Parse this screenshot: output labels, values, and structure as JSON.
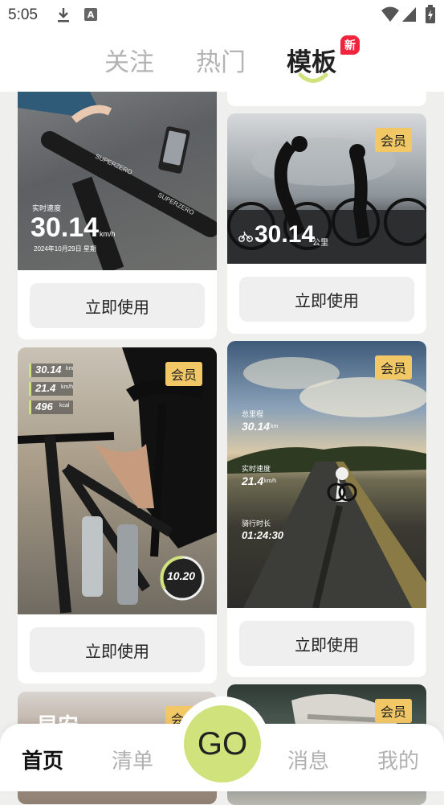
{
  "status_bar": {
    "time": "5:05",
    "notification_letter": "A"
  },
  "top_tabs": [
    {
      "label": "关注",
      "active": false
    },
    {
      "label": "热门",
      "active": false
    },
    {
      "label": "模板",
      "active": true,
      "badge": "新"
    }
  ],
  "cards": {
    "c1": {
      "button": "立即使用",
      "speed_label": "实时速度",
      "speed": "30.14",
      "unit": "km/h",
      "date": "2024年10月29日 星期",
      "brand": "SUPERZERO"
    },
    "c2": {
      "button": "立即使用",
      "vip": "会员",
      "distance": "30.14",
      "unit": "公里"
    },
    "c3": {
      "button": "立即使用",
      "vip": "会员",
      "stats": [
        {
          "value": "30.14",
          "unit": "km"
        },
        {
          "value": "21.4",
          "unit": "km/h"
        },
        {
          "value": "496",
          "unit": "kcal"
        }
      ],
      "gauge": "10.20"
    },
    "c4": {
      "button": "立即使用",
      "vip": "会员",
      "total_label": "总里程",
      "total": "30.14",
      "total_unit": "km",
      "speed_label": "实时速度",
      "speed": "21.4",
      "speed_unit": "km/h",
      "time_label": "骑行时长",
      "time": "01:24:30"
    },
    "c5": {
      "title": "早安",
      "vip": "会员"
    },
    "c6": {
      "vip": "会员"
    }
  },
  "bottom_nav": {
    "home": "首页",
    "list": "清单",
    "go": "GO",
    "messages": "消息",
    "mine": "我的"
  },
  "colors": {
    "accent_green": "#cfe27c",
    "vip_gold": "#f2c766",
    "badge_red": "#f0243c"
  }
}
